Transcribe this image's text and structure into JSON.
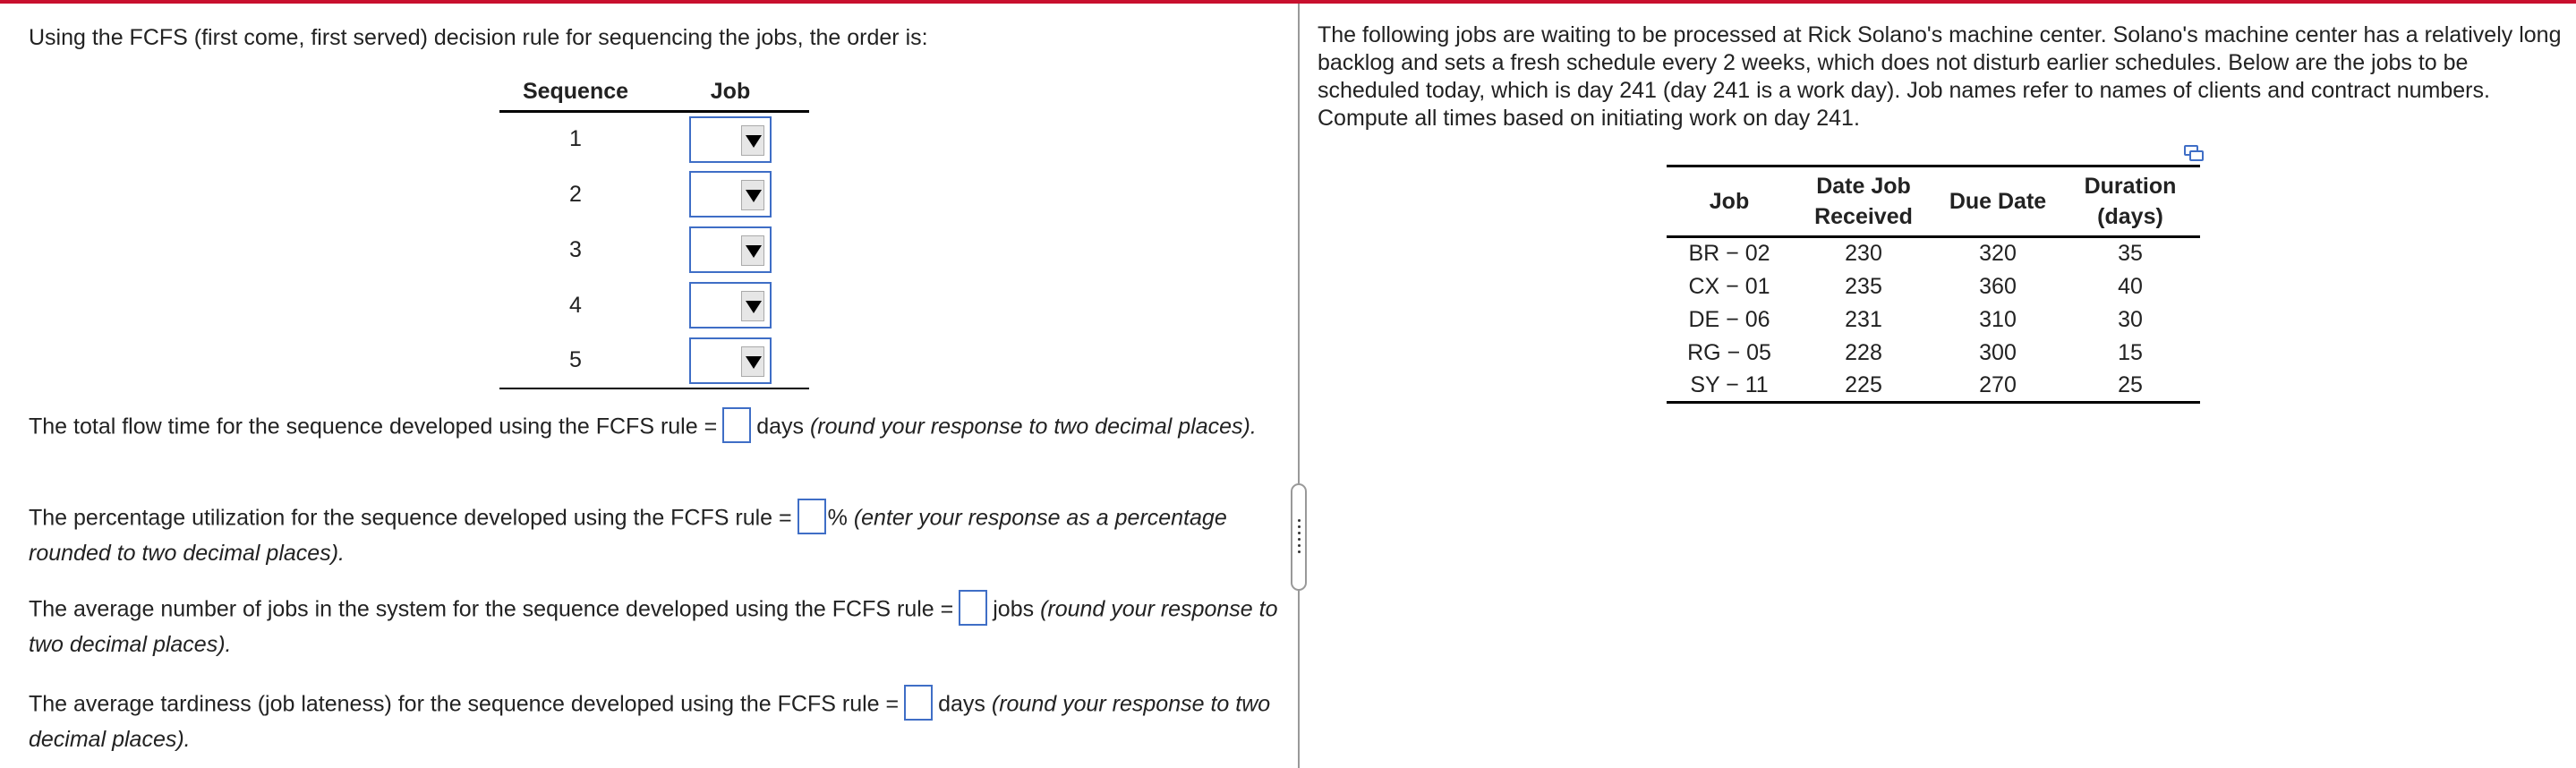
{
  "left": {
    "intro": "Using the FCFS (first come, first served) decision rule for sequencing the jobs, the order is:",
    "sequence_table": {
      "headers": [
        "Sequence",
        "Job"
      ],
      "rows": [
        "1",
        "2",
        "3",
        "4",
        "5"
      ]
    },
    "q1": {
      "before": "The total flow time for the sequence developed using the FCFS rule =",
      "unit": "days",
      "note": "(round your response to two decimal places)."
    },
    "q2": {
      "before": "The percentage utilization for the sequence developed using the FCFS rule =",
      "unit": "%",
      "note": "(enter your response as a percentage rounded to two decimal places)."
    },
    "q3": {
      "before": "The average number of jobs in the system for the sequence developed using the FCFS rule =",
      "unit": "jobs",
      "note": "(round your response to two decimal places)."
    },
    "q4": {
      "before": "The average tardiness (job lateness) for the sequence developed using the FCFS rule =",
      "unit": "days",
      "note": "(round your response to two decimal places)."
    }
  },
  "right": {
    "description": "The following jobs are waiting to be processed at Rick Solano's machine center. Solano's machine center has a relatively long backlog and sets a fresh schedule every 2 weeks, which does not disturb earlier schedules. Below are the jobs to be scheduled today, which is day 241 (day 241 is a work day). Job names refer to names of clients and contract numbers. Compute all times based on initiating work on day 241.",
    "jobs_table": {
      "headers": [
        "Job",
        "Date Job Received",
        "Due Date",
        "Duration (days)"
      ],
      "rows": [
        [
          "BR − 02",
          "230",
          "320",
          "35"
        ],
        [
          "CX − 01",
          "235",
          "360",
          "40"
        ],
        [
          "DE − 06",
          "231",
          "310",
          "30"
        ],
        [
          "RG − 05",
          "228",
          "300",
          "15"
        ],
        [
          "SY − 11",
          "225",
          "270",
          "25"
        ]
      ]
    },
    "copy_icon": "copy-icon"
  },
  "colors": {
    "top_bar": "#c8102e",
    "input_border": "#3f6ec6"
  }
}
